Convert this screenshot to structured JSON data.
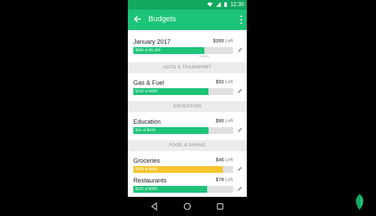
{
  "status_bar": {
    "time": "12:30"
  },
  "app_bar": {
    "title": "Budgets"
  },
  "budgets": [
    {
      "name": "January 2017",
      "amount": "$350",
      "left_label": "Left",
      "progress_label": "$950 of $1,300",
      "fraction": 0.71,
      "color": "#1cc477",
      "today_label": "TODAY"
    },
    {
      "section": "AUTO & TRANSPORT"
    },
    {
      "name": "Gas & Fuel",
      "amount": "$50",
      "left_label": "Left",
      "progress_label": "$150 of $200",
      "fraction": 0.75,
      "color": "#1cc477"
    },
    {
      "section": "EDUCATION"
    },
    {
      "name": "Education",
      "amount": "$90",
      "left_label": "Left",
      "progress_label": "$10 of $100",
      "fraction": 0.75,
      "color": "#1cc477"
    },
    {
      "section": "FOOD & DINING"
    },
    {
      "name": "Groceries",
      "amount": "$46",
      "left_label": "Left",
      "progress_label": "$438 of $484",
      "fraction": 0.9,
      "color": "#f6c52e"
    },
    {
      "name": "Restaurants",
      "amount": "$78",
      "left_label": "Left",
      "progress_label": "$222 of $300",
      "fraction": 0.74,
      "color": "#1cc477"
    }
  ],
  "icons": {
    "back": "arrow-back-icon",
    "more": "more-vert-icon",
    "pencil": "pencil-icon",
    "nav_back": "nav-back-icon",
    "nav_home": "nav-home-icon",
    "nav_recents": "nav-recents-icon",
    "brand": "mint-leaf-logo"
  },
  "colors": {
    "primary": "#1cc477",
    "primary_dark": "#12a95f",
    "warning": "#f6c52e",
    "section_bg": "#ececec"
  }
}
